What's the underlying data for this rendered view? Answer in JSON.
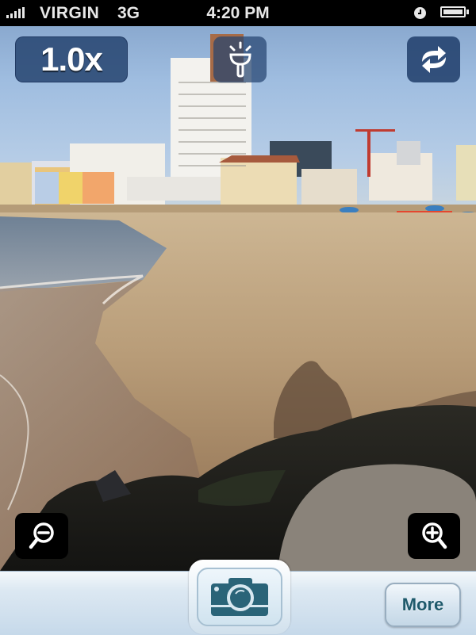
{
  "status_bar": {
    "carrier": "VIRGIN",
    "network": "3G",
    "time": "4:20 PM",
    "icons": [
      "signal-bars-icon",
      "alarm-clock-icon",
      "battery-icon"
    ]
  },
  "viewfinder": {
    "scene_description": "Beach with buildings, lifeguard tower, shadow of a seated person and rocks",
    "zoom_level": "1.0x",
    "controls": {
      "flash_icon": "flashlight-icon",
      "switch_camera_icon": "rotate-arrows-icon",
      "zoom_out_icon": "zoom-out-icon",
      "zoom_in_icon": "zoom-in-icon"
    }
  },
  "toolbar": {
    "shutter_icon": "camera-icon",
    "more_label": "More"
  },
  "colors": {
    "overlay_button": "#264470",
    "more_text": "#1f5a6c",
    "camera_icon": "#2a6478",
    "toolbar_top": "#f4f8fb",
    "toolbar_bottom": "#c6d9ea"
  }
}
